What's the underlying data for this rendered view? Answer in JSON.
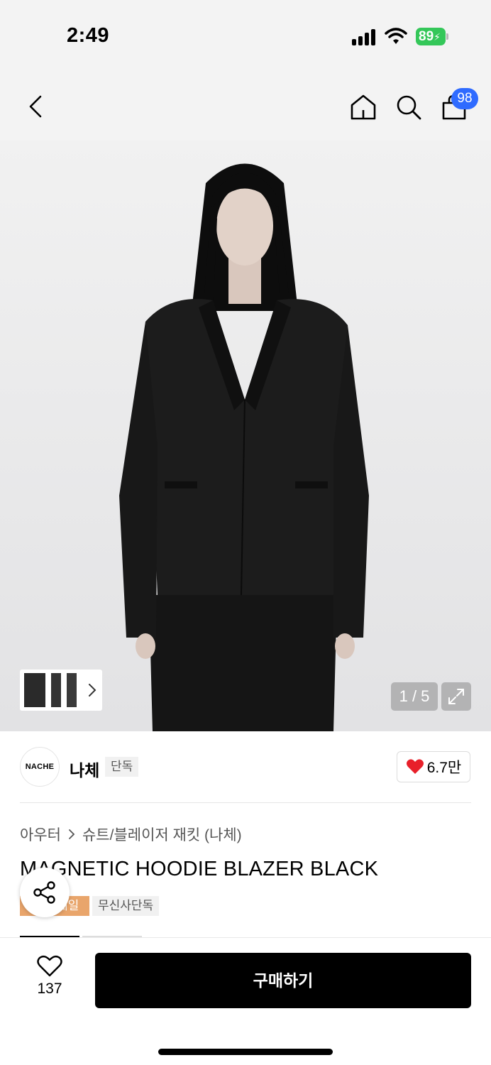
{
  "status_bar": {
    "time": "2:49",
    "battery": "89"
  },
  "header": {
    "cart_count": "98",
    "icons": [
      "chevron-left-icon",
      "home-icon",
      "search-icon",
      "bag-icon"
    ]
  },
  "gallery": {
    "page_indicator": "1 / 5"
  },
  "brand": {
    "logo_text": "NACHE",
    "name": "나체",
    "tag": "단독",
    "likes": "6.7만",
    "like_color": "#e8202a"
  },
  "product": {
    "breadcrumb": [
      "아우터",
      "슈트/블레이저 재킷 (나체)"
    ],
    "title": "MAGNETIC HOODIE BLAZER BLACK",
    "tags": [
      "세일",
      "무신사단독"
    ]
  },
  "bottom_bar": {
    "wish_count": "137",
    "buy_label": "구매하기"
  },
  "colors": {
    "accent_blue": "#2f6bff",
    "sale_orange": "#e9a56b",
    "battery_green": "#34c759"
  }
}
